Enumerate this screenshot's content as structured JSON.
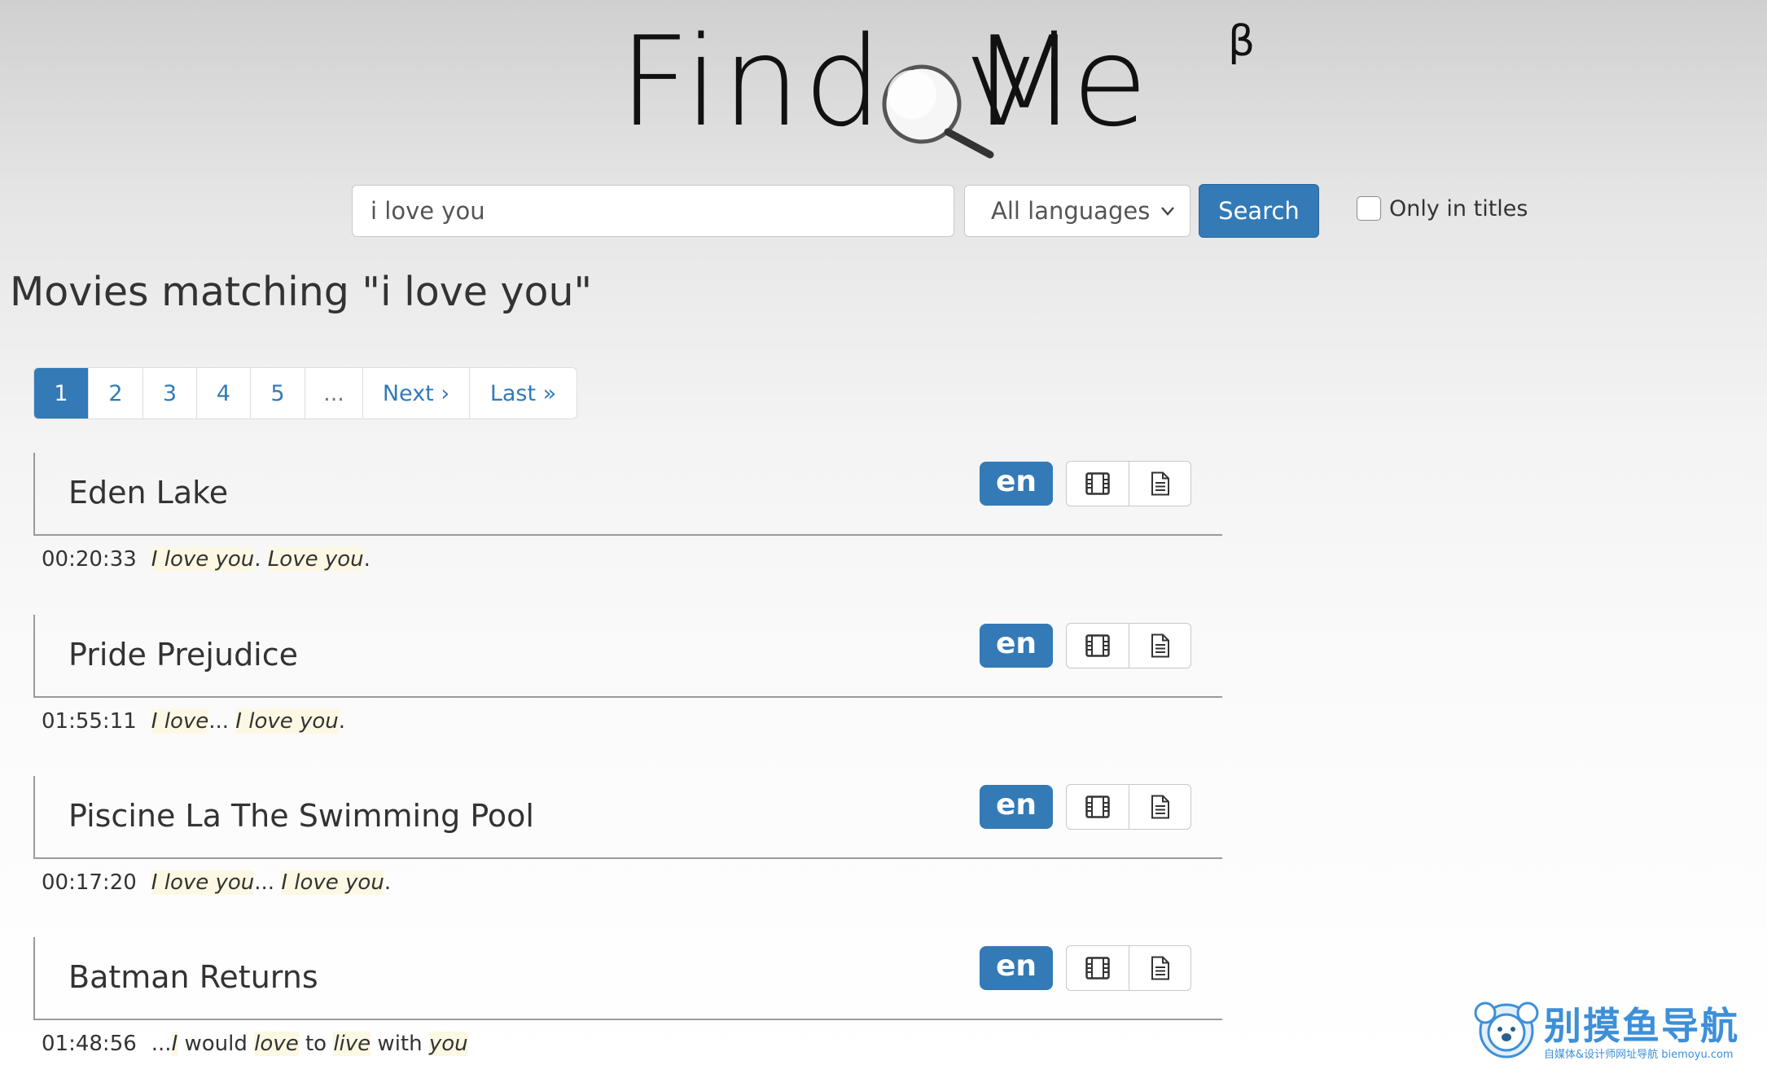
{
  "logo": {
    "text": "Find Movie",
    "superscript": "β"
  },
  "search": {
    "query": "i love you",
    "language": "All languages",
    "button_label": "Search",
    "only_titles_label": "Only in titles",
    "only_titles_checked": false
  },
  "results_heading": "Movies matching \"i love you\"",
  "pagination": {
    "pages": [
      "1",
      "2",
      "3",
      "4",
      "5"
    ],
    "ellipsis": "...",
    "next": "Next ›",
    "last": "Last »",
    "active": "1"
  },
  "results": [
    {
      "title": "Eden Lake",
      "lang": "en",
      "timestamp": "00:20:33",
      "quote": [
        {
          "t": "I love you",
          "hl": true
        },
        {
          "t": ". ",
          "hl": false
        },
        {
          "t": "Love you",
          "hl": true
        },
        {
          "t": ".",
          "hl": false
        }
      ]
    },
    {
      "title": "Pride Prejudice",
      "lang": "en",
      "timestamp": "01:55:11",
      "quote": [
        {
          "t": "I love",
          "hl": true
        },
        {
          "t": "... ",
          "hl": false
        },
        {
          "t": "I love you",
          "hl": true
        },
        {
          "t": ".",
          "hl": false
        }
      ]
    },
    {
      "title": "Piscine La The Swimming Pool",
      "lang": "en",
      "timestamp": "00:17:20",
      "quote": [
        {
          "t": "I love you",
          "hl": true
        },
        {
          "t": "... ",
          "hl": false
        },
        {
          "t": "I love you",
          "hl": true
        },
        {
          "t": ".",
          "hl": false
        }
      ]
    },
    {
      "title": "Batman Returns",
      "lang": "en",
      "timestamp": "01:48:56",
      "quote": [
        {
          "t": "...",
          "hl": false
        },
        {
          "t": "I",
          "hl": true
        },
        {
          "t": " would ",
          "hl": false
        },
        {
          "t": "love",
          "hl": true
        },
        {
          "t": " to ",
          "hl": false
        },
        {
          "t": "live",
          "hl": true
        },
        {
          "t": " with ",
          "hl": false
        },
        {
          "t": "you",
          "hl": true
        }
      ]
    }
  ],
  "watermark": {
    "name": "别摸鱼导航",
    "tagline": "自媒体&设计师网址导航 biemoyu.com"
  },
  "colors": {
    "primary": "#337ab7",
    "highlight": "#fcf8e3"
  }
}
